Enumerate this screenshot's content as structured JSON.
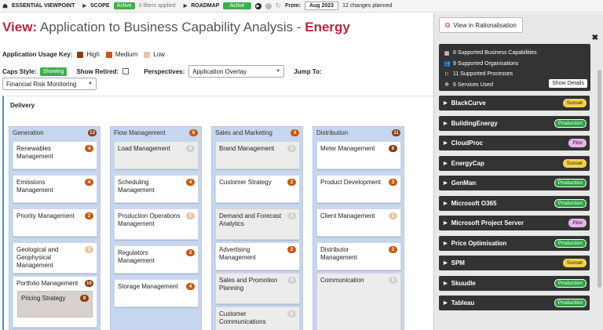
{
  "topbar": {
    "app_name": "ESSENTIAL VIEWPOINT",
    "scope_label": "SCOPE",
    "scope_status": "Active",
    "filters": "0 filters applied",
    "roadmap_label": "ROADMAP",
    "roadmap_status": "Active",
    "from_label": "From:",
    "from_date": "Aug 2023",
    "changes": "12 changes planned"
  },
  "title": {
    "prefix": "View:",
    "main": "Application to Business Capability Analysis - ",
    "highlight": "Energy"
  },
  "usage_key": {
    "label": "Application Usage Key:",
    "items": [
      {
        "label": "High",
        "color": "#8a3b12"
      },
      {
        "label": "Medium",
        "color": "#c55a11"
      },
      {
        "label": "Low",
        "color": "#ebc5a8"
      }
    ]
  },
  "options": {
    "caps_style_label": "Caps Style:",
    "caps_style_value": "Showing",
    "show_retired_label": "Show Retired:",
    "perspectives_label": "Perspectives:",
    "perspectives_value": "Application Overlay",
    "jump_to_label": "Jump To:",
    "jump_to_value": "Financial Risk Monitoring"
  },
  "frame": {
    "title": "Delivery",
    "columns": [
      {
        "name": "Generation",
        "count": "13",
        "level": "high",
        "cards": [
          {
            "name": "Renewables Management",
            "count": "4",
            "level": "med",
            "grey": false
          },
          {
            "name": "Emissions Management",
            "count": "4",
            "level": "med",
            "grey": false
          },
          {
            "name": "Priority Management",
            "count": "2",
            "level": "med",
            "grey": false
          },
          {
            "name": "Geological and Geophysical Management",
            "count": "1",
            "level": "low",
            "grey": false
          },
          {
            "name": "Portfolio Management",
            "count": "10",
            "level": "high",
            "grey": false,
            "sub": {
              "name": "Pricing Strategy",
              "count": "8",
              "level": "high"
            }
          }
        ]
      },
      {
        "name": "Flow Management",
        "count": "6",
        "level": "med",
        "cards": [
          {
            "name": "Load Management",
            "count": "0",
            "level": "none",
            "grey": true
          },
          {
            "name": "Scheduling Management",
            "count": "4",
            "level": "med",
            "grey": false
          },
          {
            "name": "Production Operations Management",
            "count": "1",
            "level": "low",
            "grey": false
          },
          {
            "name": "Regulators Management",
            "count": "2",
            "level": "med",
            "grey": false
          },
          {
            "name": "Storage Management",
            "count": "4",
            "level": "med",
            "grey": false
          }
        ]
      },
      {
        "name": "Sales and Marketing",
        "count": "4",
        "level": "med",
        "cards": [
          {
            "name": "Brand Management",
            "count": "0",
            "level": "none",
            "grey": true
          },
          {
            "name": "Customer Strategy",
            "count": "2",
            "level": "med",
            "grey": false
          },
          {
            "name": "Demand and Forecast Analytics",
            "count": "0",
            "level": "none",
            "grey": true
          },
          {
            "name": "Advertising Management",
            "count": "2",
            "level": "med",
            "grey": false
          },
          {
            "name": "Sales and Promotion Planning",
            "count": "0",
            "level": "none",
            "grey": true
          },
          {
            "name": "Customer Communications",
            "count": "0",
            "level": "none",
            "grey": true
          }
        ]
      },
      {
        "name": "Distribution",
        "count": "11",
        "level": "high",
        "cards": [
          {
            "name": "Meter Management",
            "count": "6",
            "level": "high",
            "grey": false
          },
          {
            "name": "Product Development",
            "count": "3",
            "level": "med",
            "grey": false
          },
          {
            "name": "Client Management",
            "count": "1",
            "level": "low",
            "grey": false
          },
          {
            "name": "Distributor Management",
            "count": "2",
            "level": "med",
            "grey": false
          },
          {
            "name": "Communication",
            "count": "0",
            "level": "none",
            "grey": true
          }
        ]
      }
    ]
  },
  "panel": {
    "rationalisation_button": "View in Rationalisation",
    "close": "✖",
    "summary": [
      {
        "icon": "grid-icon",
        "glyph": "▦",
        "text": "8 Supported Business Capabilities"
      },
      {
        "icon": "organisations-icon",
        "glyph": "👥",
        "text": "9 Supported Organisations"
      },
      {
        "icon": "processes-icon",
        "glyph": "⚐",
        "text": "11 Supported Processes"
      },
      {
        "icon": "services-icon",
        "glyph": "✲",
        "text": "6 Services Used"
      }
    ],
    "show_details": "Show Details",
    "apps": [
      {
        "name": "BlackCurve",
        "status": "Sunset"
      },
      {
        "name": "BuildingEnergy",
        "status": "Production"
      },
      {
        "name": "CloudProc",
        "status": "Pilot"
      },
      {
        "name": "EnergyCap",
        "status": "Sunset"
      },
      {
        "name": "GenMan",
        "status": "Production"
      },
      {
        "name": "Microsoft O365",
        "status": "Production"
      },
      {
        "name": "Microsoft Project Server",
        "status": "Pilot"
      },
      {
        "name": "Price Optimisation",
        "status": "Production"
      },
      {
        "name": "SPM",
        "status": "Sunset"
      },
      {
        "name": "Skuudle",
        "status": "Production"
      },
      {
        "name": "Tableau",
        "status": "Production"
      }
    ]
  }
}
